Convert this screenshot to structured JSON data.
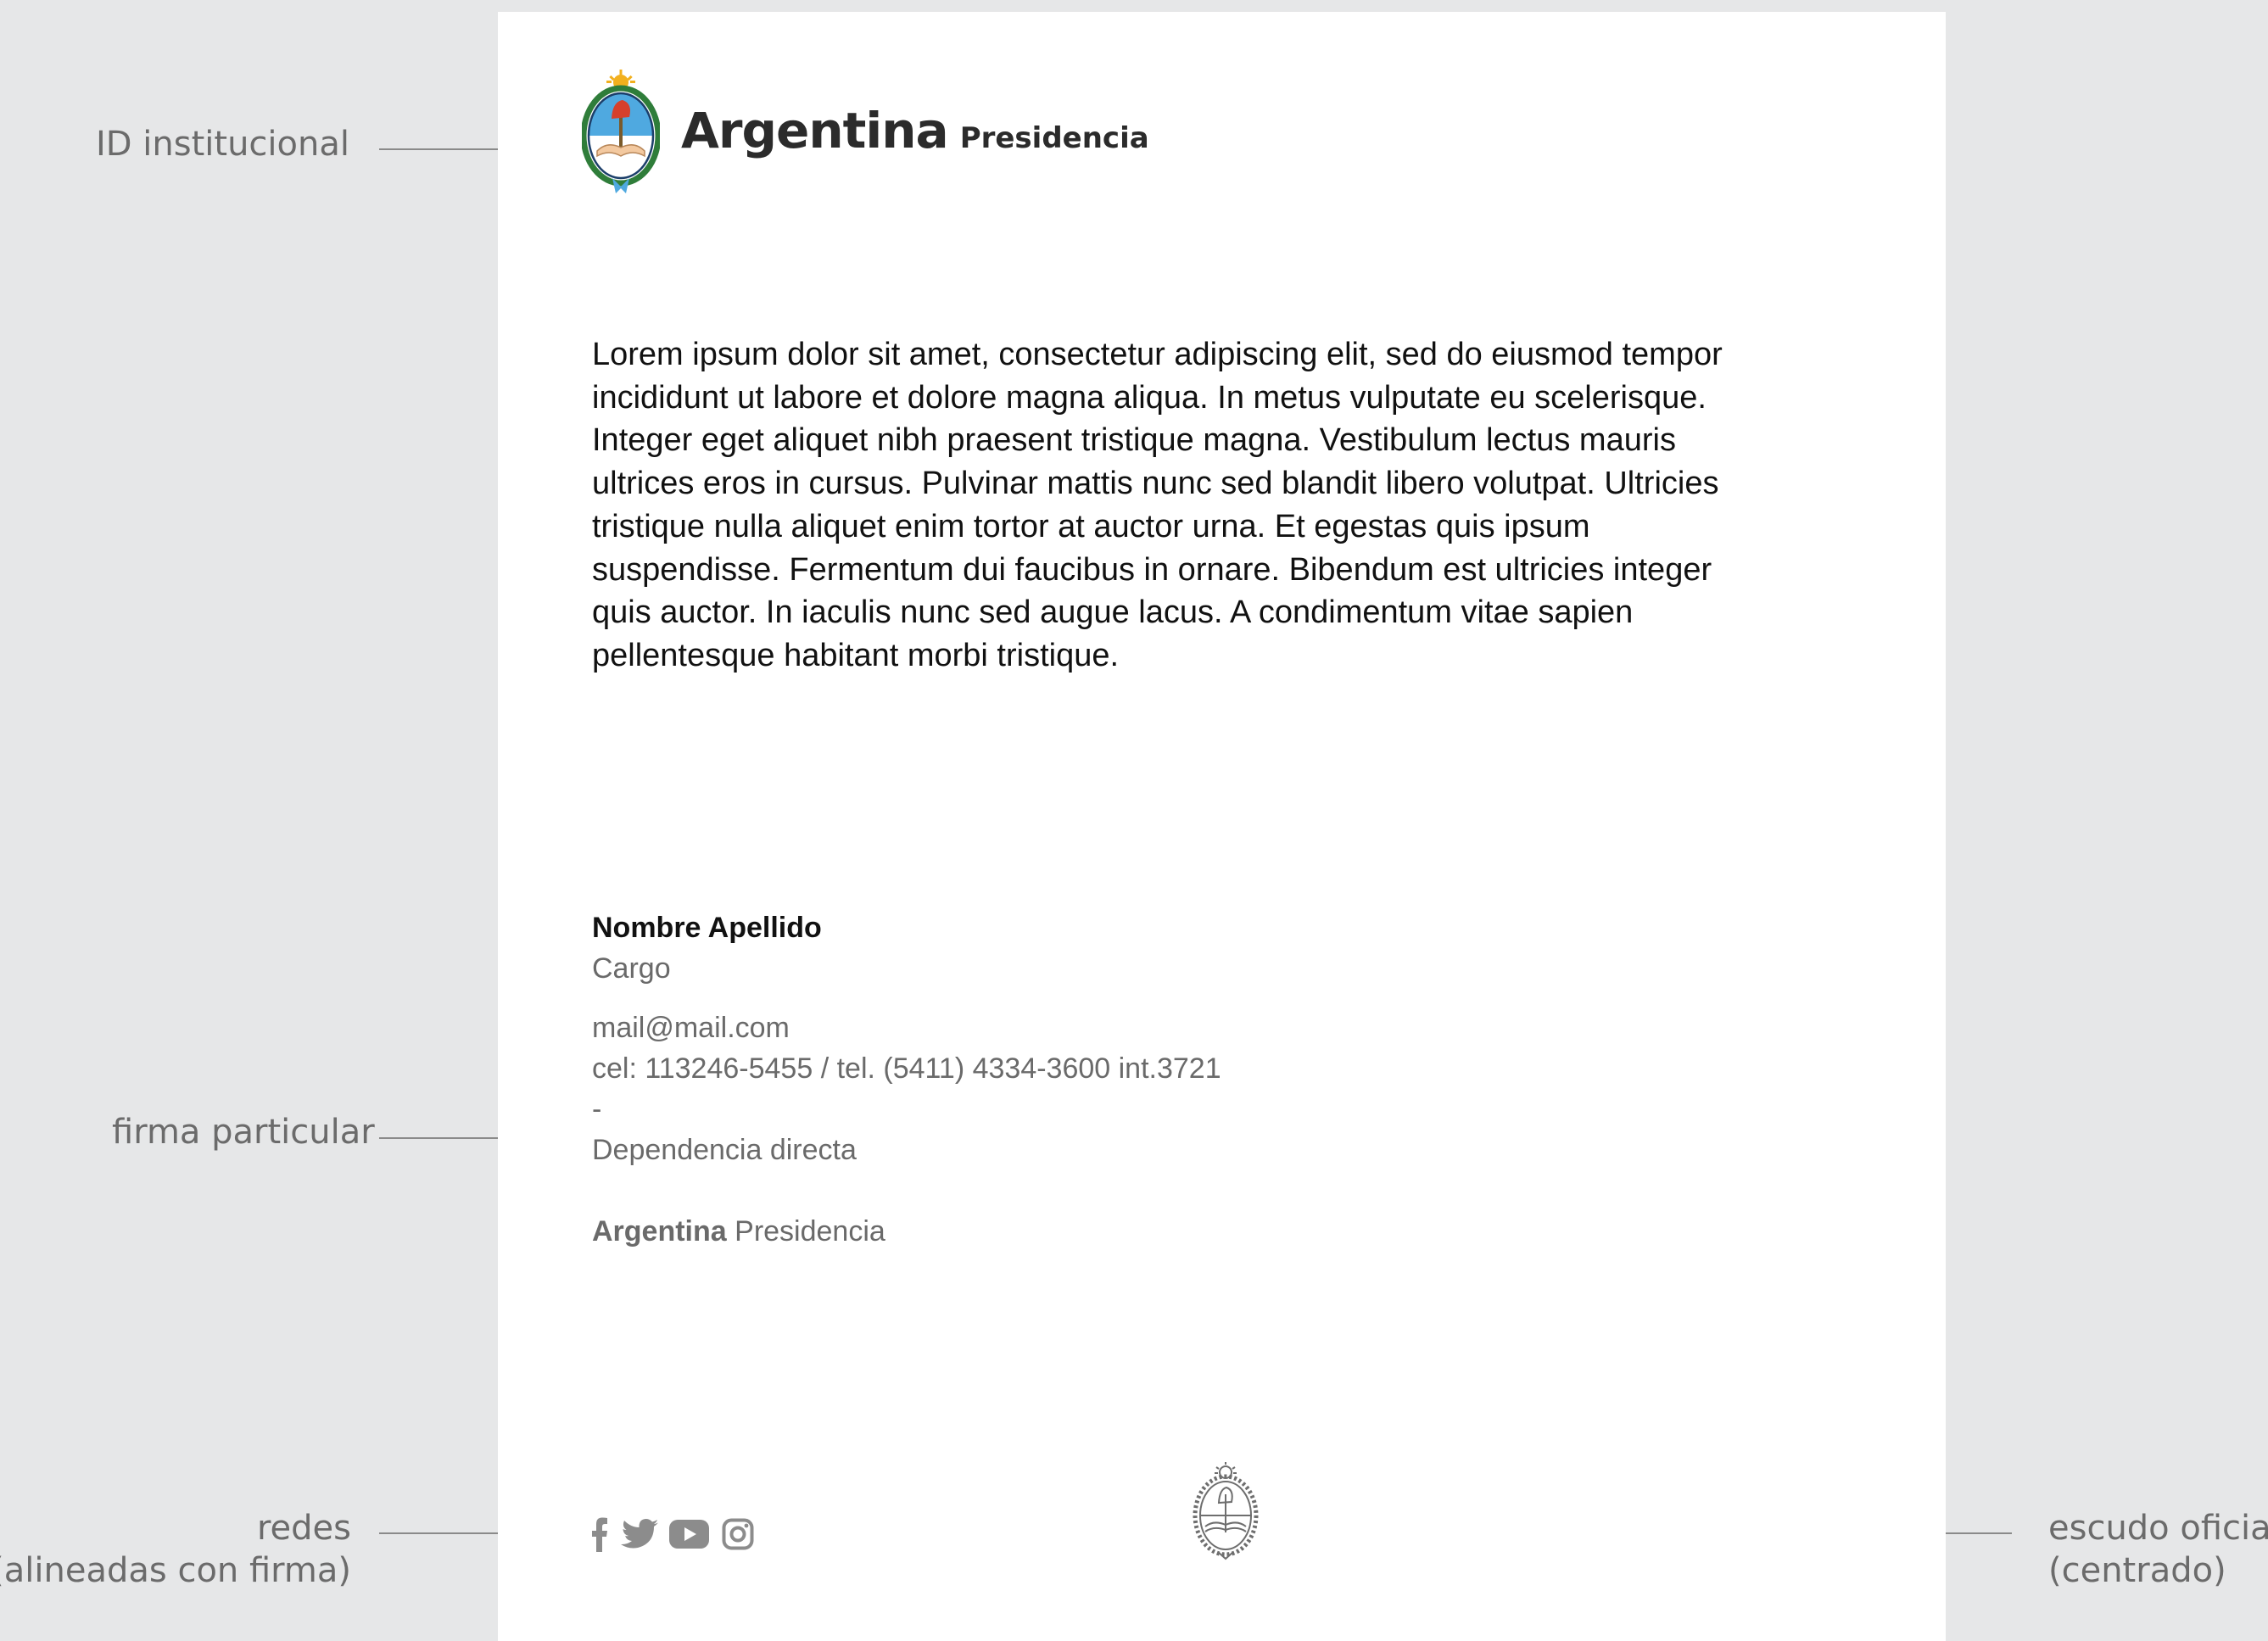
{
  "annotations": {
    "id_institucional": "ID institucional",
    "firma_particular": "firma particular",
    "redes_line1": "redes",
    "redes_line2": "(alineadas con firma)",
    "escudo_line1": "escudo oficial",
    "escudo_line2": "(centrado)"
  },
  "header": {
    "brand": "Argentina",
    "sub": "Presidencia",
    "logo_icon": "coat-of-arms-color"
  },
  "body": {
    "paragraph": "Lorem ipsum dolor sit amet, consectetur adipiscing elit, sed do eiusmod tempor incididunt ut labore et dolore magna aliqua. In metus vulputate eu scelerisque. Integer eget aliquet nibh praesent tristique magna. Vestibulum lectus mauris ultrices eros in cursus. Pulvinar mattis nunc sed blandit libero volutpat. Ultricies tristique nulla aliquet enim tortor at auctor urna. Et egestas quis ipsum suspendisse. Fermentum dui faucibus in ornare. Bibendum est ultricies integer quis auctor. In iaculis nunc sed augue lacus. A condimentum vitae sapien pellentesque habitant morbi tristique."
  },
  "signature": {
    "name": "Nombre Apellido",
    "role": "Cargo",
    "email": "mail@mail.com",
    "phones": "cel: 113246-5455 / tel. (5411) 4334-3600 int.3721",
    "separator": "-",
    "department": "Dependencia directa",
    "org_bold": "Argentina",
    "org_rest": "Presidencia"
  },
  "social": [
    "facebook-icon",
    "twitter-icon",
    "youtube-icon",
    "instagram-icon"
  ],
  "colors": {
    "background": "#e6e7e8",
    "sheet": "#ffffff",
    "annotation": "#6b6b6b",
    "signature_gray": "#6a6a6a",
    "icon_gray": "#8c8c8c"
  }
}
